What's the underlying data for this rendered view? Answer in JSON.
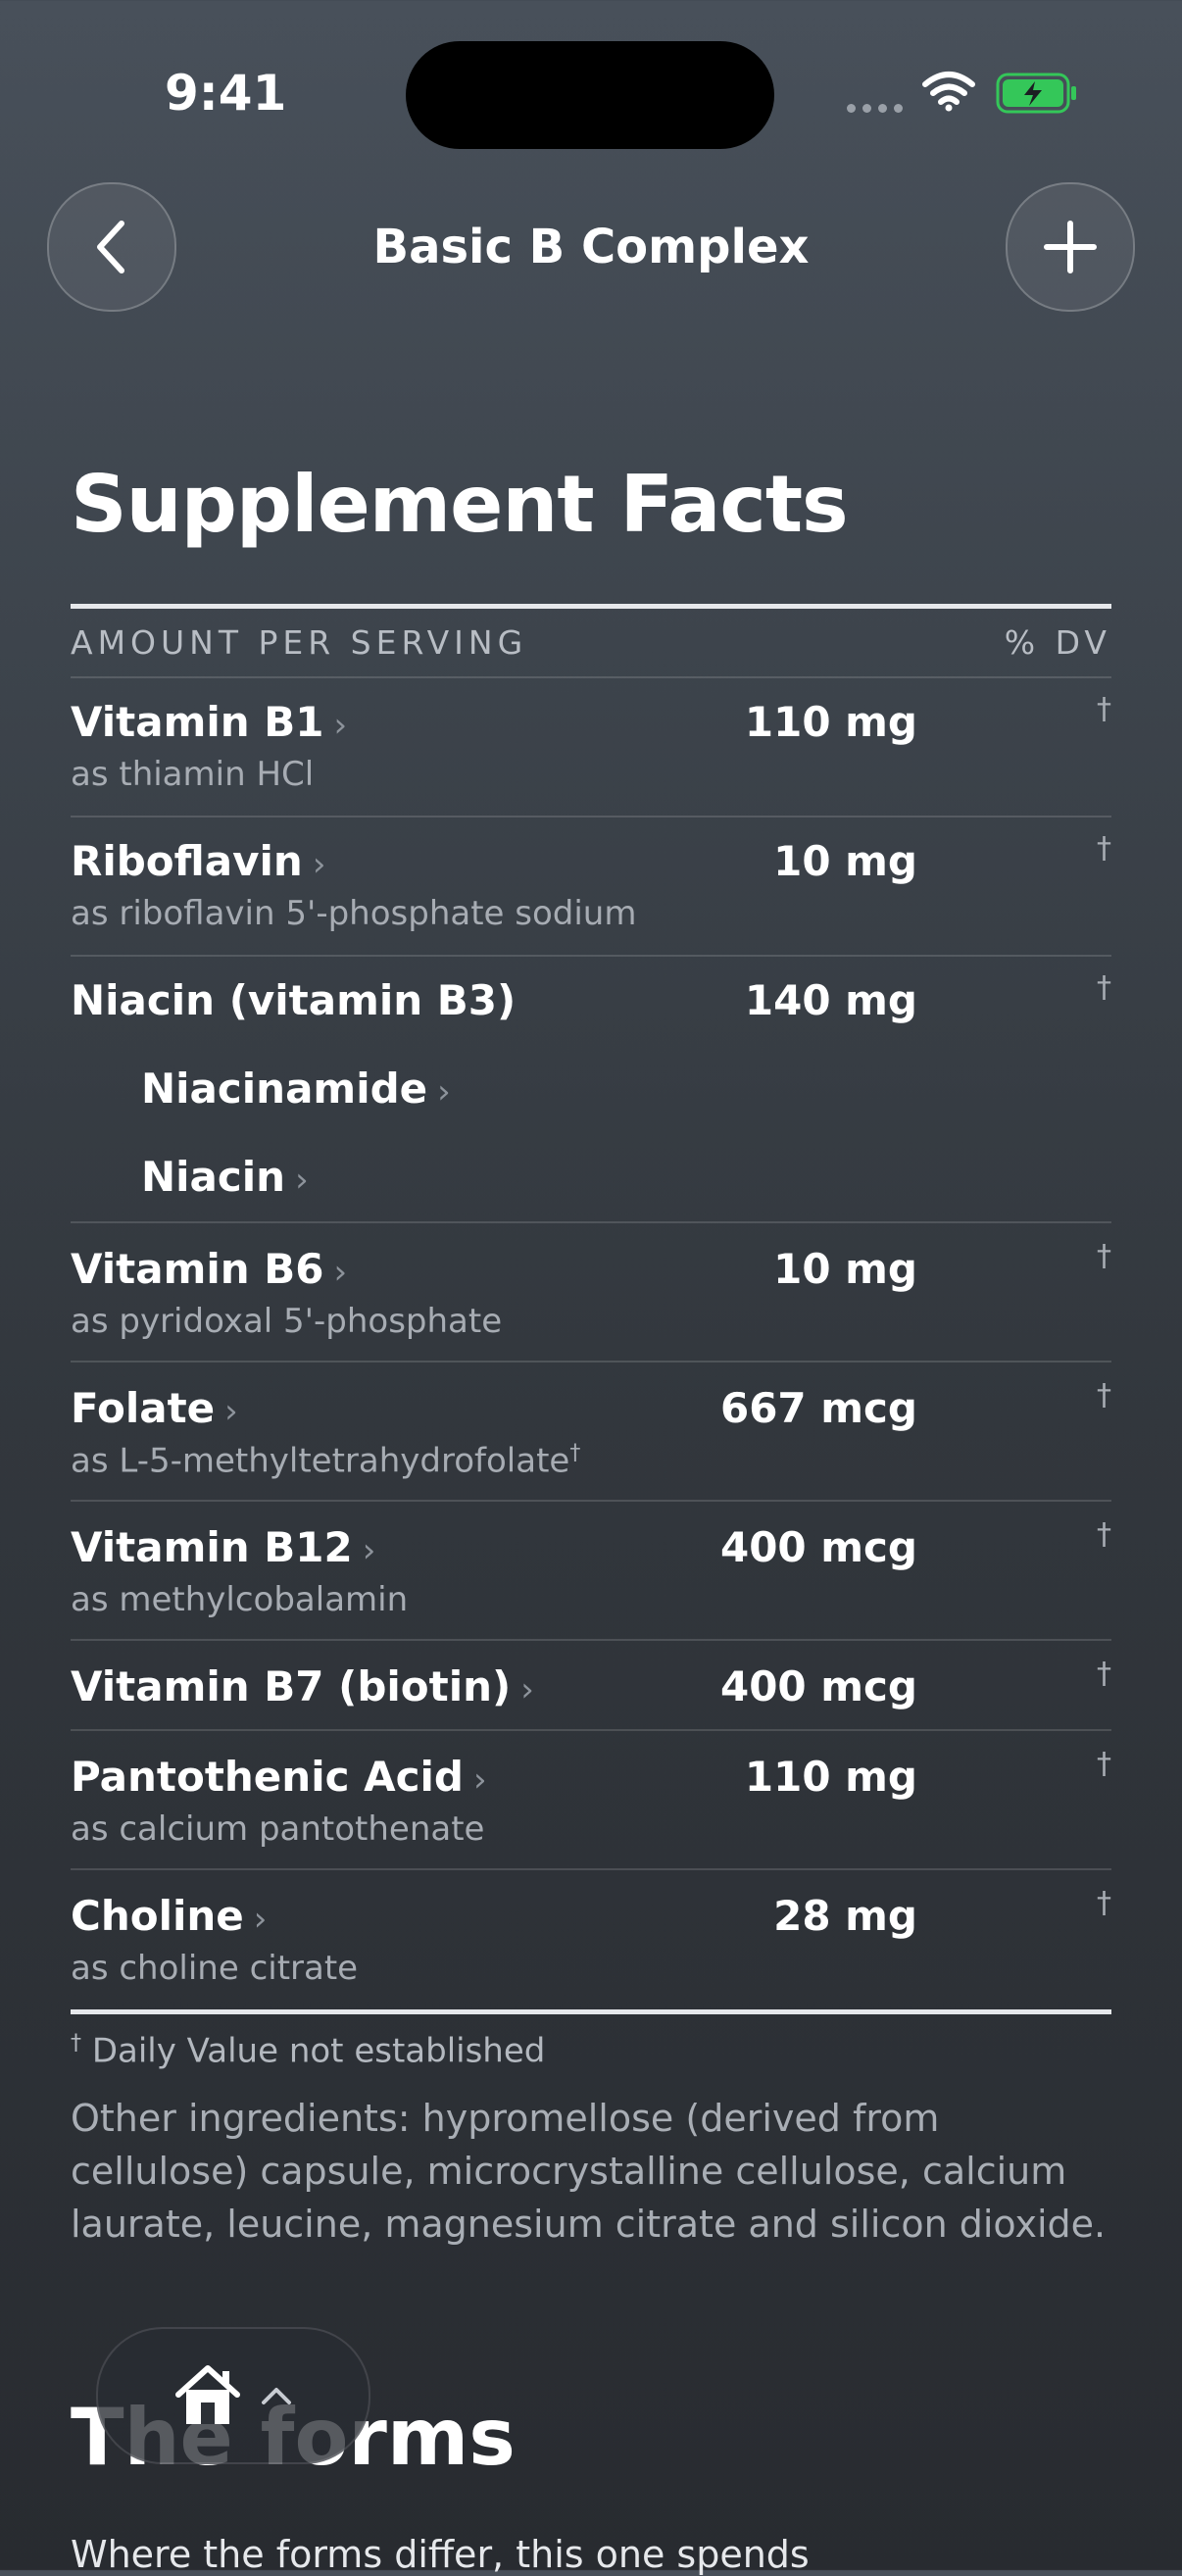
{
  "status_bar": {
    "time": "9:41"
  },
  "nav": {
    "title": "Basic B Complex"
  },
  "facts": {
    "title": "Supplement Facts",
    "header_left": "AMOUNT PER SERVING",
    "header_right": "% DV",
    "rows": [
      {
        "name": "Vitamin B1",
        "chevron": "›",
        "sub": "as thiamin HCl",
        "amount": "110 mg",
        "dv": "†"
      },
      {
        "name": "Riboflavin",
        "chevron": "›",
        "sub": "as riboflavin 5'-phosphate sodium",
        "amount": "10 mg",
        "dv": "†"
      },
      {
        "name": "Niacin (vitamin B3)",
        "amount": "140 mg",
        "dv": "†",
        "children": [
          {
            "name": "Niacinamide",
            "chevron": "›"
          },
          {
            "name": "Niacin",
            "chevron": "›"
          }
        ]
      },
      {
        "name": "Vitamin B6",
        "chevron": "›",
        "sub": "as pyridoxal 5'-phosphate",
        "amount": "10 mg",
        "dv": "†"
      },
      {
        "name": "Folate",
        "chevron": "›",
        "sub": "as L-5-methyltetrahydrofolate",
        "sub_mark": "†",
        "amount": "667 mcg",
        "dv": "†"
      },
      {
        "name": "Vitamin B12",
        "chevron": "›",
        "sub": "as methylcobalamin",
        "amount": "400 mcg",
        "dv": "†"
      },
      {
        "name": "Vitamin B7 (biotin)",
        "chevron": "›",
        "amount": "400 mcg",
        "dv": "†"
      },
      {
        "name": "Pantothenic Acid",
        "chevron": "›",
        "sub": "as calcium pantothenate",
        "amount": "110 mg",
        "dv": "†"
      },
      {
        "name": "Choline",
        "chevron": "›",
        "sub": "as choline citrate",
        "amount": "28 mg",
        "dv": "†"
      }
    ],
    "footnote_mark": "†",
    "footnote": "Daily Value not established",
    "other_ingredients": "Other ingredients: hypromellose (derived from cellulose) capsule, microcrystalline cellulose, calcium laurate, leucine, magnesium citrate and silicon dioxide."
  },
  "forms": {
    "title": "The forms",
    "text": "Where the forms differ, this one spends"
  },
  "icons": {
    "back": "chevron-left-icon",
    "add": "plus-icon",
    "home": "home-icon",
    "expand": "chevron-up-icon"
  },
  "colors": {
    "background_top": "#48505a",
    "background_bottom": "#282b30",
    "battery_green": "#34c759"
  }
}
